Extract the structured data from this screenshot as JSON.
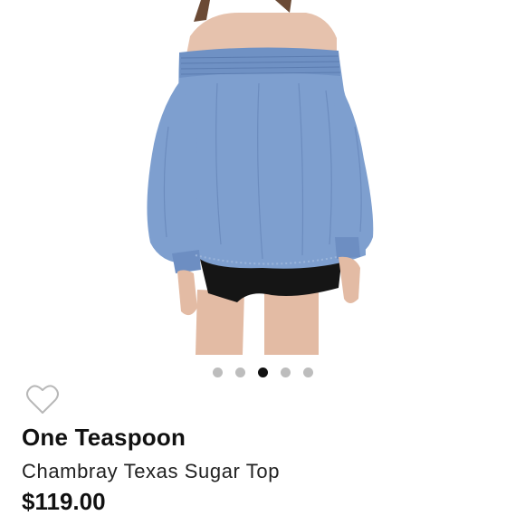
{
  "product": {
    "brand": "One Teaspoon",
    "title": "Chambray Texas Sugar Top",
    "price": "$119.00",
    "image_subject": "model wearing blue chambray off-shoulder top with black shorts"
  },
  "carousel": {
    "dots": 5,
    "active_index": 2
  },
  "icons": {
    "like": "heart-outline-icon"
  },
  "colors": {
    "chambray": "#7e9fcf",
    "chambray_shadow": "#6585b8",
    "skin": "#e6c2ad",
    "shorts": "#151515",
    "dot_inactive": "#bdbdbd",
    "dot_active": "#111111",
    "heart_stroke": "#b8b8b8"
  }
}
